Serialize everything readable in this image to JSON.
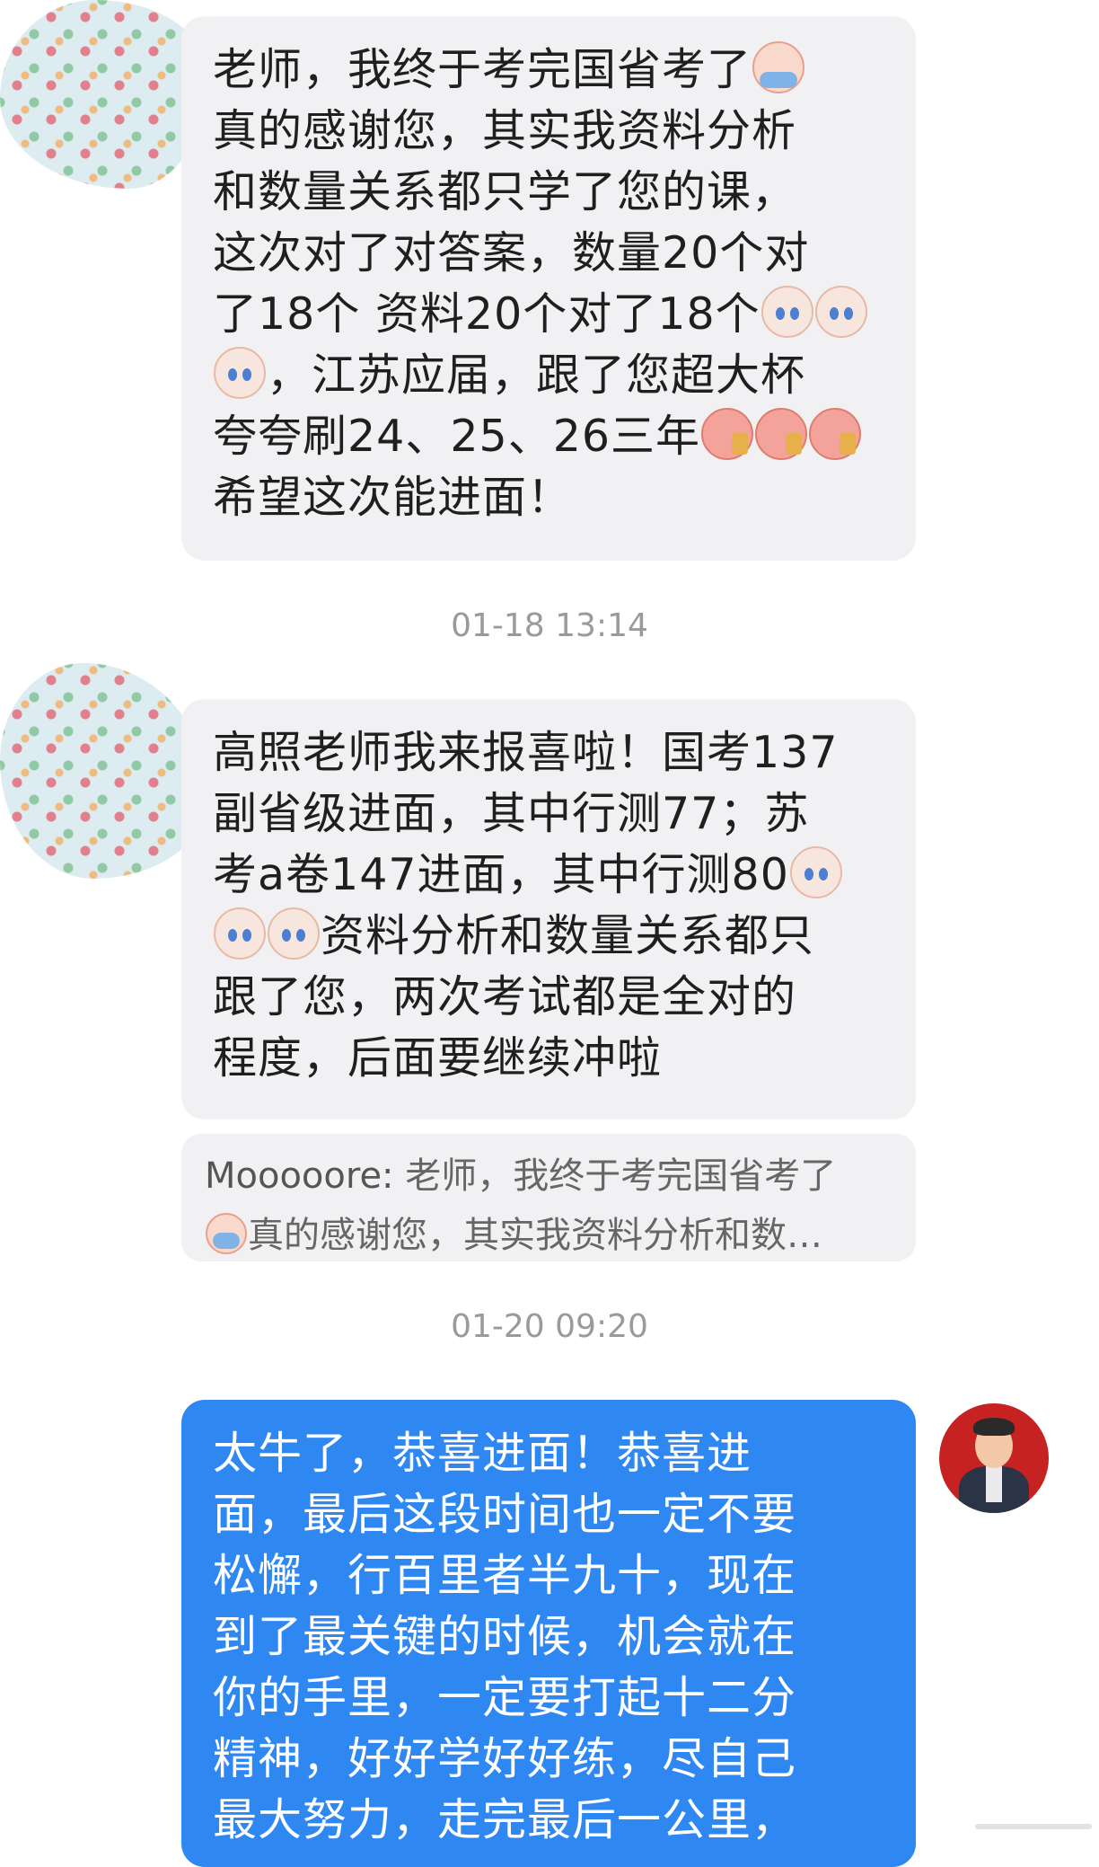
{
  "messages": [
    {
      "text_1": "老师，我终于考完国省考了",
      "text_2": "\n真的感谢您，其实我资料分析\n和数量关系都只学了您的课，\n这次对了对答案，数量20个对\n了18个 资料20个对了18个",
      "text_3": "，江苏应届，跟了您超大杯\n夸夸刷24、25、26三年",
      "text_4": "\n希望这次能进面！",
      "emoji_1": "crying-face-icon",
      "emoji_cat": "crying-cat-icon",
      "emoji_tea": "milk-tea-face-icon"
    },
    {
      "text_1": "高照老师我来报喜啦！国考137\n副省级进面，其中行测77；苏\n考a卷147进面，其中行测80",
      "text_2": "资料分析和数量关系都只\n跟了您，两次考试都是全对的\n程度，后面要继续冲啦"
    }
  ],
  "timestamps": [
    "01-18 13:14",
    "01-20 09:20"
  ],
  "quote": {
    "author": "Mooooore: ",
    "line_1": "老师，我终于考完国省考了",
    "line_2": "真的感谢您，其实我资料分析和数…"
  },
  "reply": {
    "text": "太牛了，恭喜进面！恭喜进\n面，最后这段时间也一定不要\n松懈，行百里者半九十，现在\n到了最关键的时候，机会就在\n你的手里，一定要打起十二分\n精神，好好学好好练，尽自己\n最大努力，走完最后一公里，"
  },
  "colors": {
    "incoming_bubble": "#f1f1f3",
    "outgoing_bubble": "#2f87f2",
    "timestamp": "#9a9a9a"
  }
}
